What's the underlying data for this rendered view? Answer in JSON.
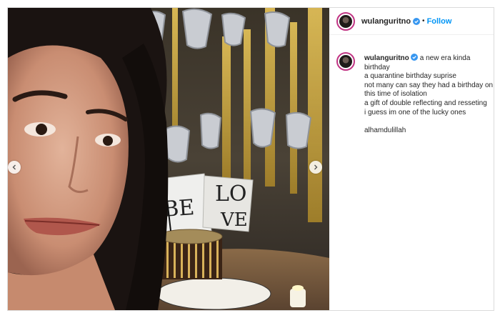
{
  "post": {
    "username": "wulanguritno",
    "follow_label": "Follow",
    "separator": "•",
    "caption_lines": [
      "a new era kinda birthday",
      "a quarantine birthday suprise",
      "not many can say they had a birthday on this time of isolation",
      "a gift of double reflecting and resseting",
      "i guess im one of the lucky ones",
      "",
      "alhamdulillah"
    ]
  },
  "icons": {
    "verified": "verified-badge-icon",
    "prev": "chevron-left-icon",
    "next": "chevron-right-icon"
  },
  "colors": {
    "follow": "#0095f6",
    "verified": "#3897f0",
    "story_ring": "#c13584"
  }
}
